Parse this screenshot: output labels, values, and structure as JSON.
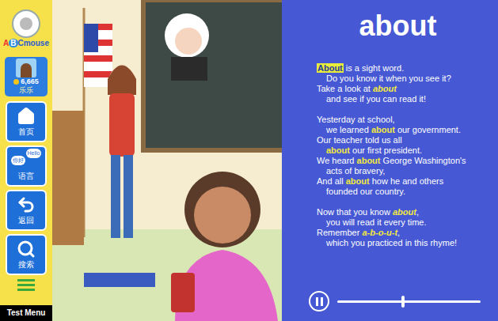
{
  "sidebar": {
    "logo": {
      "prefix": "A",
      "badge": "B",
      "suffix": "Cmouse"
    },
    "profile": {
      "coins": "6,665",
      "name": "乐乐"
    },
    "nav": [
      {
        "label": "首页",
        "kind": "home",
        "bubbles": []
      },
      {
        "label": "语言",
        "kind": "language",
        "bubbles": [
          "你好",
          "Hello"
        ]
      },
      {
        "label": "返回",
        "kind": "back",
        "bubbles": []
      },
      {
        "label": "搜索",
        "kind": "search",
        "bubbles": []
      }
    ],
    "menu": "Test Menu"
  },
  "panel": {
    "title": "about",
    "paragraphs": [
      [
        {
          "kind": "start",
          "segments": [
            {
              "text": "About",
              "kind": "current"
            },
            {
              "text": " is a sight word.",
              "kind": "text"
            }
          ]
        },
        {
          "kind": "indent",
          "segments": [
            {
              "text": "Do you know it when you see it?",
              "kind": "text"
            }
          ]
        },
        {
          "kind": "start",
          "segments": [
            {
              "text": "Take a look at ",
              "kind": "text"
            },
            {
              "text": "about",
              "kind": "spelled"
            }
          ]
        },
        {
          "kind": "indent",
          "segments": [
            {
              "text": "and see if you can read it!",
              "kind": "text"
            }
          ]
        }
      ],
      [
        {
          "kind": "start",
          "segments": [
            {
              "text": "Yesterday at school,",
              "kind": "text"
            }
          ]
        },
        {
          "kind": "indent",
          "segments": [
            {
              "text": "we learned ",
              "kind": "text"
            },
            {
              "text": "about",
              "kind": "word"
            },
            {
              "text": " our government.",
              "kind": "text"
            }
          ]
        },
        {
          "kind": "start",
          "segments": [
            {
              "text": "Our teacher told us all",
              "kind": "text"
            }
          ]
        },
        {
          "kind": "indent",
          "segments": [
            {
              "text": "about",
              "kind": "word"
            },
            {
              "text": " our first president.",
              "kind": "text"
            }
          ]
        },
        {
          "kind": "start",
          "segments": [
            {
              "text": "We heard ",
              "kind": "text"
            },
            {
              "text": "about",
              "kind": "word"
            },
            {
              "text": " George Washington's",
              "kind": "text"
            }
          ]
        },
        {
          "kind": "indent",
          "segments": [
            {
              "text": "acts of bravery,",
              "kind": "text"
            }
          ]
        },
        {
          "kind": "start",
          "segments": [
            {
              "text": "And all ",
              "kind": "text"
            },
            {
              "text": "about",
              "kind": "word"
            },
            {
              "text": " how he and others",
              "kind": "text"
            }
          ]
        },
        {
          "kind": "indent",
          "segments": [
            {
              "text": "founded our country.",
              "kind": "text"
            }
          ]
        }
      ],
      [
        {
          "kind": "start",
          "segments": [
            {
              "text": "Now that you know ",
              "kind": "text"
            },
            {
              "text": "about",
              "kind": "spelled"
            },
            {
              "text": ",",
              "kind": "text"
            }
          ]
        },
        {
          "kind": "indent",
          "segments": [
            {
              "text": "you will read it every time.",
              "kind": "text"
            }
          ]
        },
        {
          "kind": "start",
          "segments": [
            {
              "text": "Remember ",
              "kind": "text"
            },
            {
              "text": "a-b-o-u-t",
              "kind": "spelled"
            },
            {
              "text": ",",
              "kind": "text"
            }
          ]
        },
        {
          "kind": "indent",
          "segments": [
            {
              "text": "which you practiced in this rhyme!",
              "kind": "text"
            }
          ]
        }
      ]
    ]
  },
  "player": {
    "playing": true,
    "level": 0.46
  }
}
